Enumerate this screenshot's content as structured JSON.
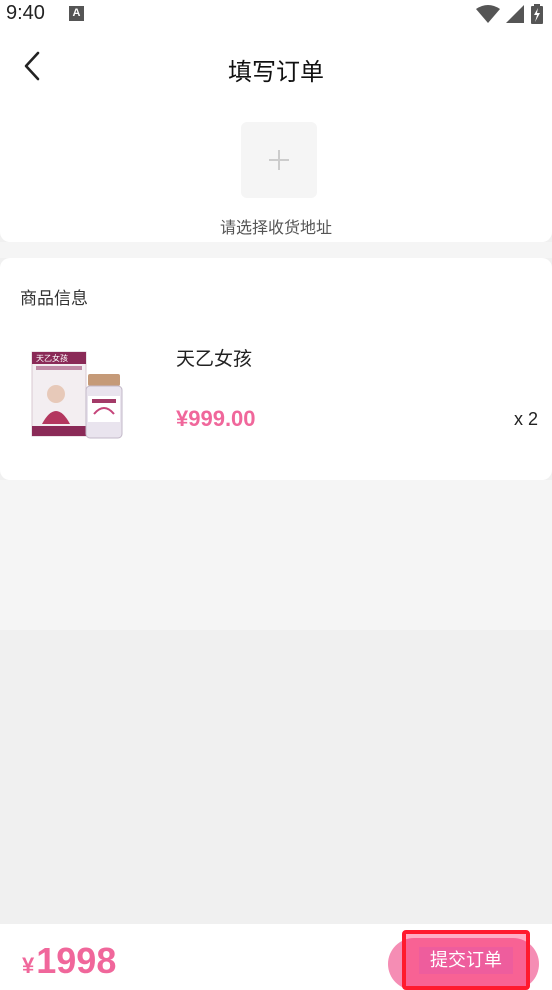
{
  "status_bar": {
    "time": "9:40",
    "notification_icon": "A",
    "icons": [
      "wifi-icon",
      "signal-icon",
      "battery-charging-icon"
    ]
  },
  "header": {
    "back_icon": "chevron-left-icon",
    "title": "填写订单"
  },
  "address": {
    "add_icon": "plus-icon",
    "hint": "请选择收货地址"
  },
  "product_section": {
    "title": "商品信息",
    "items": [
      {
        "name": "天乙女孩",
        "price": "¥999.00",
        "quantity": "x 2",
        "image_brand": "天乙女孩"
      }
    ]
  },
  "footer": {
    "currency": "¥",
    "total": "1998",
    "submit_label": "提交订单"
  },
  "colors": {
    "accent": "#f0679b",
    "button": "#f58db4",
    "highlight_border": "#ff1a2e"
  }
}
